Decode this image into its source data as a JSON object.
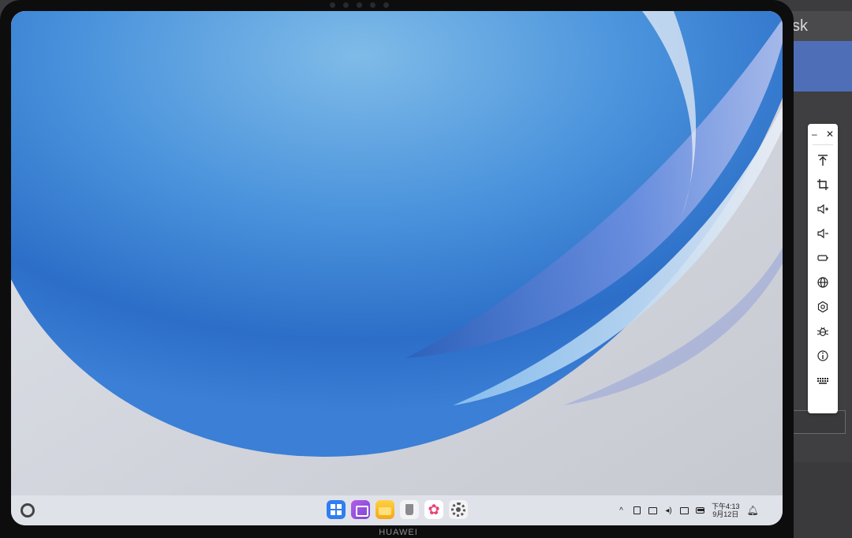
{
  "host_window": {
    "title_fragment": "sk"
  },
  "device": {
    "brand": "HUAWEI"
  },
  "taskbar": {
    "apps": [
      {
        "name": "app-grid-icon"
      },
      {
        "name": "gallery-icon"
      },
      {
        "name": "files-icon"
      },
      {
        "name": "trash-icon"
      },
      {
        "name": "petal-flower-icon"
      },
      {
        "name": "settings-icon"
      }
    ],
    "clock": {
      "time": "下午4:13",
      "date": "9月12日"
    }
  },
  "emulator_toolbar": {
    "minimize_label": "–",
    "close_label": "✕",
    "buttons": [
      "upload-icon",
      "crop-screenshot-icon",
      "volume-up-icon",
      "volume-down-icon",
      "power-button-icon",
      "globe-icon",
      "settings-gear-icon",
      "bug-debug-icon",
      "info-icon",
      "keyboard-icon"
    ]
  },
  "colors": {
    "accent_blue": "#4e6fb7",
    "wallpaper_blue": "#3d83d6"
  }
}
